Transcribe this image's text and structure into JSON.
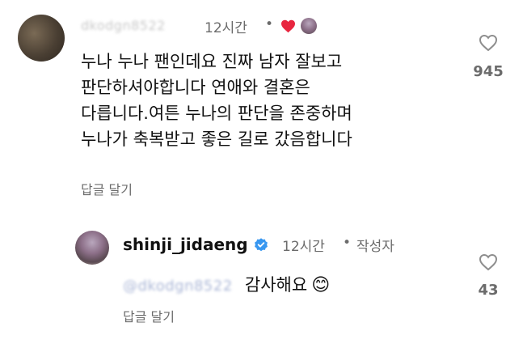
{
  "comment": {
    "author_blurred": "dkodgn8522",
    "time": "12시간",
    "separator": "•",
    "text_lines": [
      "누나 누나 팬인데요 진짜 남자 잘보고",
      "판단하셔야합니다 연애와 결혼은",
      "다릅니다.여튼 누나의 판단을 존중하며",
      "누나가 축복받고 좋은 길로 갔음합니다"
    ],
    "reply_label": "답글 달기",
    "like_count": "945",
    "creator_liked_icon": "heart-icon",
    "creator_liked_color": "#e8263f"
  },
  "reply": {
    "author": "shinji_jidaeng",
    "time": "12시간",
    "separator": "•",
    "author_badge": "작성자",
    "mention_blurred": "@dkodgn8522",
    "text": "감사해요",
    "emoji": "😊",
    "reply_label": "답글 달기",
    "like_count": "43",
    "verified_color": "#3897f0"
  }
}
